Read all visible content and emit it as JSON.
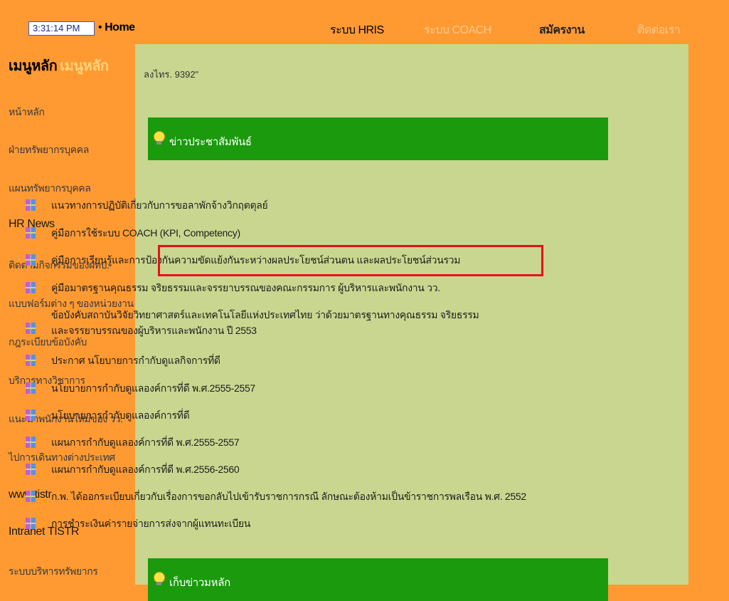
{
  "header": {
    "clock": "3:31:14 PM",
    "home_label": "Home",
    "home_sep": "•",
    "nav": [
      "ระบบ HRIS",
      "ระบบ COACH",
      "สมัครงาน",
      "ติดต่อเรา"
    ]
  },
  "sidebar": {
    "title": "เมนูหลัก",
    "title_ghost": "เมนูหลัก",
    "items": [
      "หน้าหลัก",
      "ฝ่ายทรัพยากรบุคคล",
      "แผนทรัพยากรบุคคล",
      "HR News",
      "ติดตามกิจกรรมของฝทบ.",
      "แบบฟอร์มต่าง ๆ ของหน่วยงาน",
      "กฎระเบียบข้อบังคับ",
      "บริการทางวิชาการ",
      "แนะนำพนักงานใหม่ของ วว.",
      "ไปการเดินทางต่างประเทศ",
      "www.tistr",
      "Intranet TISTR",
      "ระบบบริหารทรัพยากร"
    ]
  },
  "main": {
    "counter": "ลงไทร. 9392\"",
    "section_news": "ข่าวประชาสัมพันธ์",
    "section_bottom": "เก็บข่าวมหลัก",
    "news": [
      "แนวทางการปฏิบัติเกี่ยวกับการขอลาพักจ้างวิกฤตตุลย์",
      "คู่มือการใช้ระบบ COACH (KPI, Competency)",
      "คู่มือการเรียนรู้และการป้องกันความขัดแย้งกันระหว่างผลประโยชน์ส่วนตน และผลประโยชน์ส่วนรวม",
      "คู่มือมาตรฐานคุณธรรม จริยธรรมและจรรยาบรรณของคณะกรรมการ ผู้บริหารและพนักงาน วว.",
      "ข้อบังคับสถาบันวิจัยวิทยาศาสตร์และเทคโนโลยีแห่งประเทศไทย ว่าด้วยมาตรฐานทางคุณธรรม จริยธรรม และจรรยาบรรณของผู้บริหารและพนักงาน ปี 2553",
      "ประกาศ นโยบายการกำกับดูแลกิจการที่ดี",
      "นโยบายการกำกับดูแลองค์การที่ดี พ.ศ.2555-2557",
      "นโยบายการกำกับดูแลองค์การที่ดี",
      "แผนการกำกับดูแลองค์การที่ดี พ.ศ.2555-2557",
      "แผนการกำกับดูแลองค์การที่ดี พ.ศ.2556-2560",
      "ก.พ. ได้ออกระเบียบเกี่ยวกับเรื่องการขอกลับไปเข้ารับราชการกรณี ลักษณะต้องห้ามเป็นข้าราชการพลเรือน พ.ศ. 2552",
      "การชำระเงินค่ารายจ่ายการส่งจากผู้แทนทะเบียน"
    ]
  },
  "colors": {
    "frame": "#ff9a33",
    "content": "#c9d68f",
    "section": "#1a9a0c",
    "highlight": "#e8101a"
  }
}
